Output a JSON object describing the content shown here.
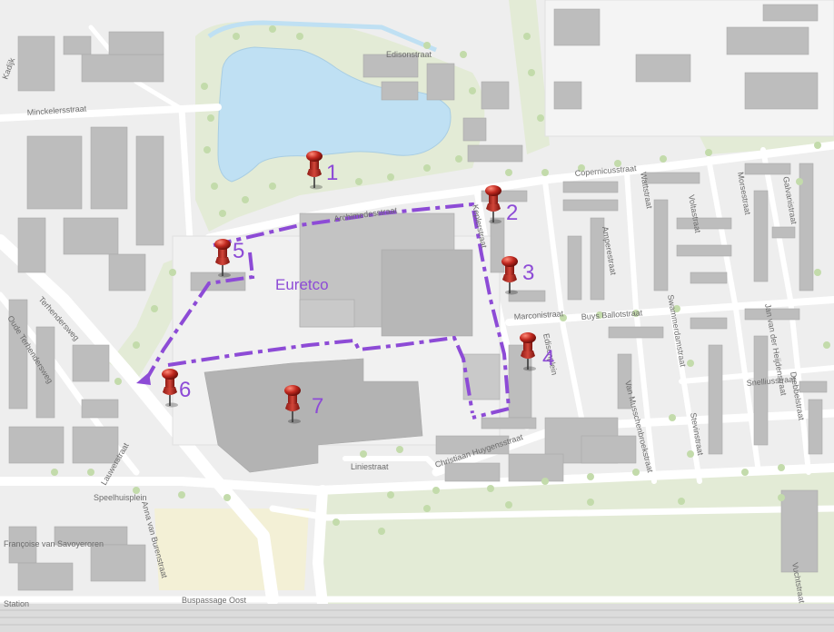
{
  "map": {
    "area_label": "Euretco",
    "streets": {
      "edisonstraat": "Edisonstraat",
      "minckelersstraat": "Minckelersstraat",
      "kadijk": "Kadijk",
      "archimedesstraat": "Archimedesstraat",
      "keplerstraat": "Keplerstraat",
      "copernicusstraat": "Copernicusstraat",
      "wattstraat": "Wattstraat",
      "voltastraat": "Voltastraat",
      "morsestraat": "Morsestraat",
      "galvanistraat": "Galvanistraat",
      "amperestraat": "Amperestraat",
      "marconistraat": "Marconistraat",
      "buys_ballotstraat": "Buys Ballotstraat",
      "edisonplein": "Edisonplein",
      "swammerdamstraat": "Swammerdamstraat",
      "jan_van_der_heijdenstraat": "Jan van der Heijdenstraat",
      "snelliusstraat": "Snelliusstraat",
      "drebbelstraat": "Drebbelstraat",
      "stevinstraat": "Stevinstraat",
      "van_musschenbroekstraat": "Van Musschenbroekstraat",
      "christiaan_huygensstraat": "Christiaan Huygensstraat",
      "liniestraat": "Liniestraat",
      "terhendersweg": "Terhendersweg",
      "oude_terhendersweg": "Oude Terhendersweg",
      "lauwerstraat": "Lauwerstraat",
      "speelhuisplein": "Speelhuisplein",
      "anna_van_burenstraat": "Anna van Burenstraat",
      "francoise_van_savoyeroren": "Françoise van Savoyeroren",
      "buspassage_oost": "Buspassage Oost",
      "station": "Station",
      "vuchtstraat": "Vuchtstraat"
    },
    "markers": [
      {
        "label": "1"
      },
      {
        "label": "2"
      },
      {
        "label": "3"
      },
      {
        "label": "4"
      },
      {
        "label": "5"
      },
      {
        "label": "6"
      },
      {
        "label": "7"
      }
    ],
    "colors": {
      "background": "#eeeeee",
      "road": "#ffffff",
      "building": "#bdbdbd",
      "building_light": "#d2d2d2",
      "green": "#e3ebd6",
      "tree": "#c3dbab",
      "water": "#bfe0f3",
      "boundary": "#8d4bd6",
      "marker": "#b5251d",
      "label": "#8d4bd6",
      "rail": "#d6d6d6"
    }
  }
}
